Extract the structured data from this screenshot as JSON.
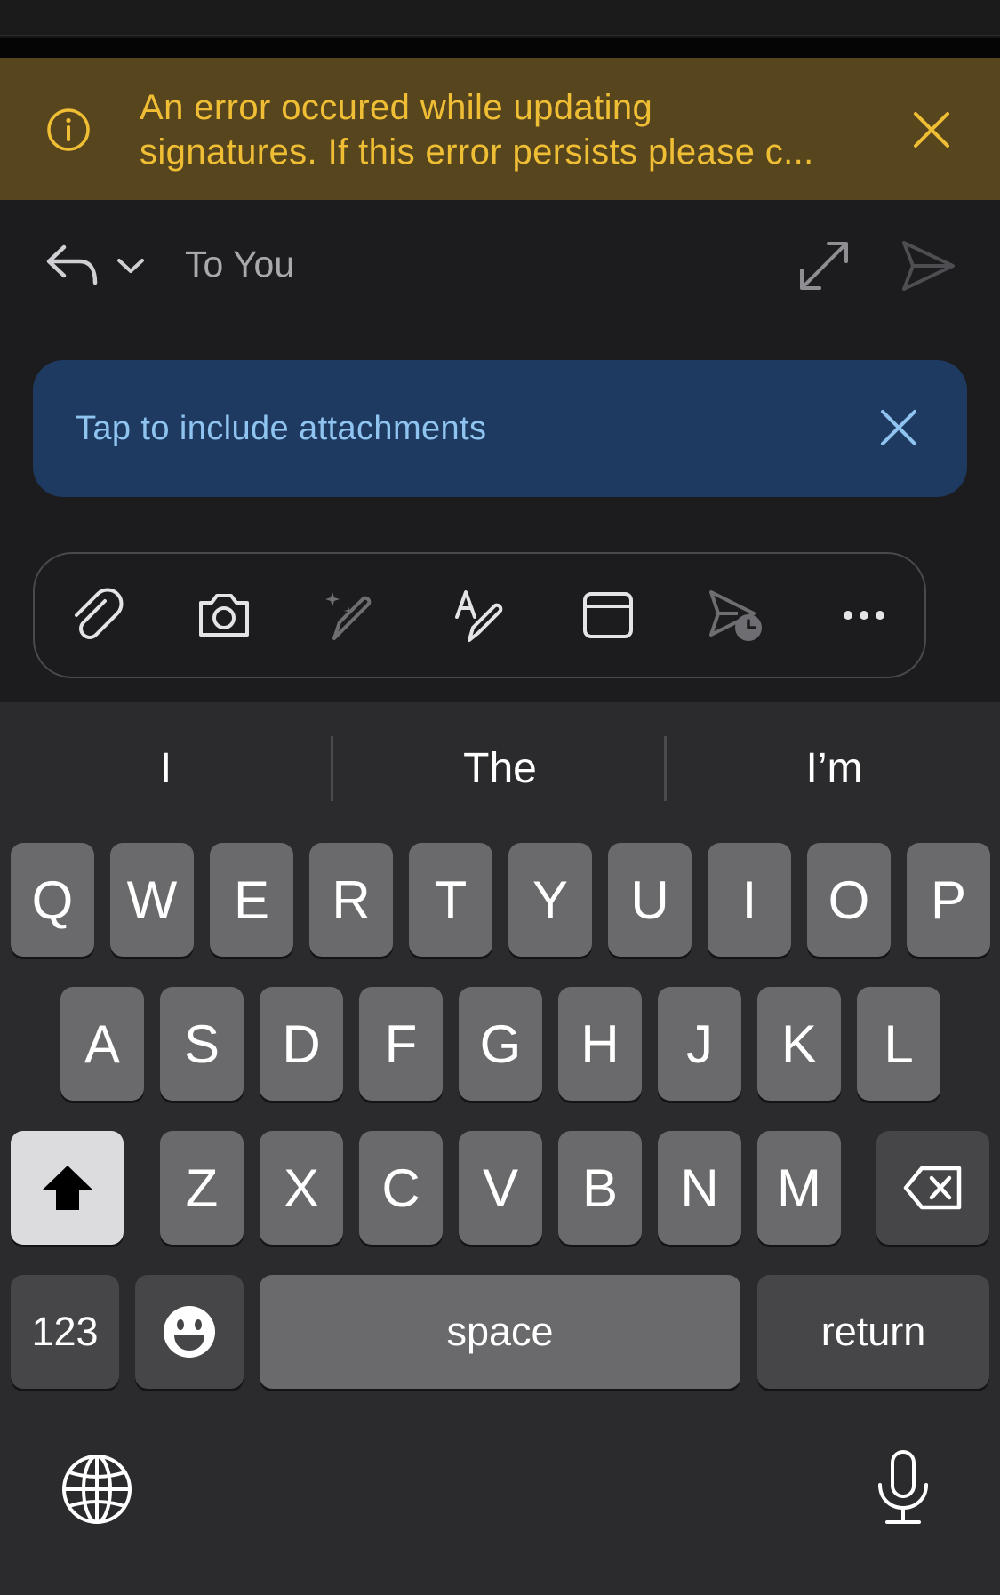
{
  "error_banner": {
    "line1": "An error occured while updating",
    "line2": "signatures. If this error persists please c...",
    "color": "#f0be35"
  },
  "compose": {
    "to_label": "To You"
  },
  "attachments_banner": {
    "text": "Tap to include attachments",
    "color": "#8fc3f0"
  },
  "toolbar": {
    "icons": [
      "paperclip-icon",
      "camera-icon",
      "magic-pen-icon",
      "format-text-icon",
      "calendar-icon",
      "schedule-send-icon",
      "more-icon"
    ]
  },
  "keyboard": {
    "suggestions": [
      "I",
      "The",
      "I’m"
    ],
    "row1": [
      "Q",
      "W",
      "E",
      "R",
      "T",
      "Y",
      "U",
      "I",
      "O",
      "P"
    ],
    "row2": [
      "A",
      "S",
      "D",
      "F",
      "G",
      "H",
      "J",
      "K",
      "L"
    ],
    "row3": [
      "Z",
      "X",
      "C",
      "V",
      "B",
      "N",
      "M"
    ],
    "numbers_label": "123",
    "space_label": "space",
    "return_label": "return"
  }
}
